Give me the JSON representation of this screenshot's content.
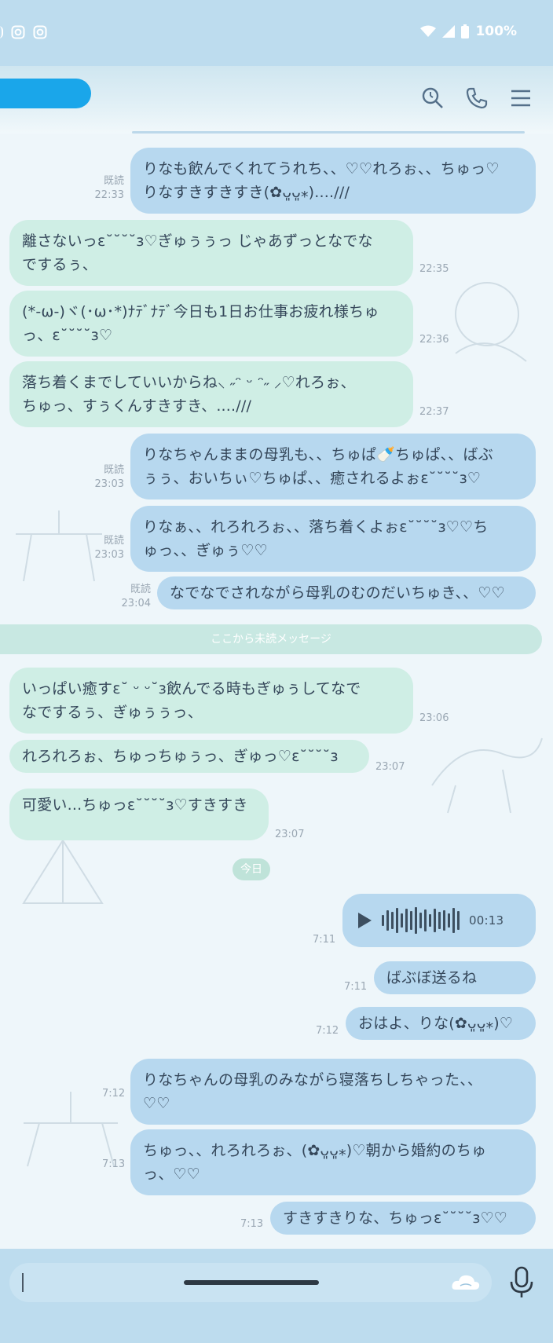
{
  "status": {
    "battery": "100%"
  },
  "divider_label": "ここから未読メッセージ",
  "today_label": "今日",
  "messages": [
    {
      "side": "out",
      "read": "既読",
      "time": "22:33",
      "lines": [
        "りなも飲んでくれてうれち、、♡♡れろぉ、、ちゅっ♡",
        "りなすきすきすき(✿ᴗ͈ᴗ͈⁎)....///"
      ]
    },
    {
      "side": "in",
      "time": "22:35",
      "lines": [
        "離さないっɛ˘˘˘˘ɜ♡ぎゅぅぅっ じゃあずっとなでな",
        "でするぅ、"
      ]
    },
    {
      "side": "in",
      "time": "22:36",
      "lines": [
        "(*-ω-)ヾ(･ω･*)ﾅﾃﾞﾅﾃﾞ今日も1日お仕事お疲れ様ちゅ",
        "っ、ɛ˘˘˘˘ɜ♡"
      ]
    },
    {
      "side": "in",
      "time": "22:37",
      "lines": [
        "落ち着くまでしていいからね⸜ ˶ᵔ ᵕ ᵔ˶ ⸝♡れろぉ、",
        "ちゅっ、すぅくんすきすき、....///"
      ]
    },
    {
      "side": "out",
      "read": "既読",
      "time": "23:03",
      "lines": [
        "りなちゃんままの母乳も、、ちゅぱ🍼ちゅぱ、、ばぶ",
        "ぅぅ、おいちぃ♡ちゅぱ、、癒されるよぉɛ˘˘˘˘ɜ♡"
      ]
    },
    {
      "side": "out",
      "read": "既読",
      "time": "23:03",
      "lines": [
        "りなぁ、、れろれろぉ、、落ち着くよぉɛ˘˘˘˘ɜ♡♡ち",
        "ゅっ、、ぎゅぅ♡♡"
      ]
    },
    {
      "side": "out",
      "read": "既読",
      "time": "23:04",
      "lines": [
        "なでなでされながら母乳のむのだいちゅき、、♡♡"
      ]
    },
    {
      "side": "in",
      "time": "23:06",
      "lines": [
        "いっぱい癒すɛ˘ ᵕ ᵕ˘ɜ飲んでる時もぎゅぅしてなで",
        "なでするぅ、ぎゅぅぅっ、"
      ]
    },
    {
      "side": "in",
      "time": "23:07",
      "lines": [
        "れろれろぉ、ちゅっちゅぅっ、ぎゅっ♡ɛ˘˘˘˘ɜ"
      ]
    },
    {
      "side": "in",
      "time": "23:07",
      "lines": [
        "可愛い...ちゅっɛ˘˘˘˘ɜ♡すきすき"
      ]
    },
    {
      "side": "out",
      "time": "7:11",
      "voice": true,
      "duration": "00:13"
    },
    {
      "side": "out",
      "time": "7:11",
      "lines": [
        "ばぶぼ送るね"
      ]
    },
    {
      "side": "out",
      "time": "7:12",
      "lines": [
        "おはよ、りな(✿ᴗ͈ᴗ͈⁎)♡"
      ]
    },
    {
      "side": "out",
      "time": "7:12",
      "lines": [
        "りなちゃんの母乳のみながら寝落ちしちゃった、、",
        "♡♡"
      ]
    },
    {
      "side": "out",
      "time": "7:13",
      "lines": [
        "ちゅっ、、れろれろぉ、(✿ᴗ͈ᴗ͈⁎)♡朝から婚約のちゅ",
        "っ、♡♡"
      ]
    },
    {
      "side": "out",
      "time": "7:13",
      "lines": [
        "すきすきりな、ちゅっɛ˘˘˘˘ɜ♡♡"
      ]
    }
  ],
  "icons": {
    "header": [
      "search-icon",
      "phone-icon",
      "menu-icon"
    ],
    "input": [
      "sticker-icon",
      "mic-icon"
    ]
  }
}
